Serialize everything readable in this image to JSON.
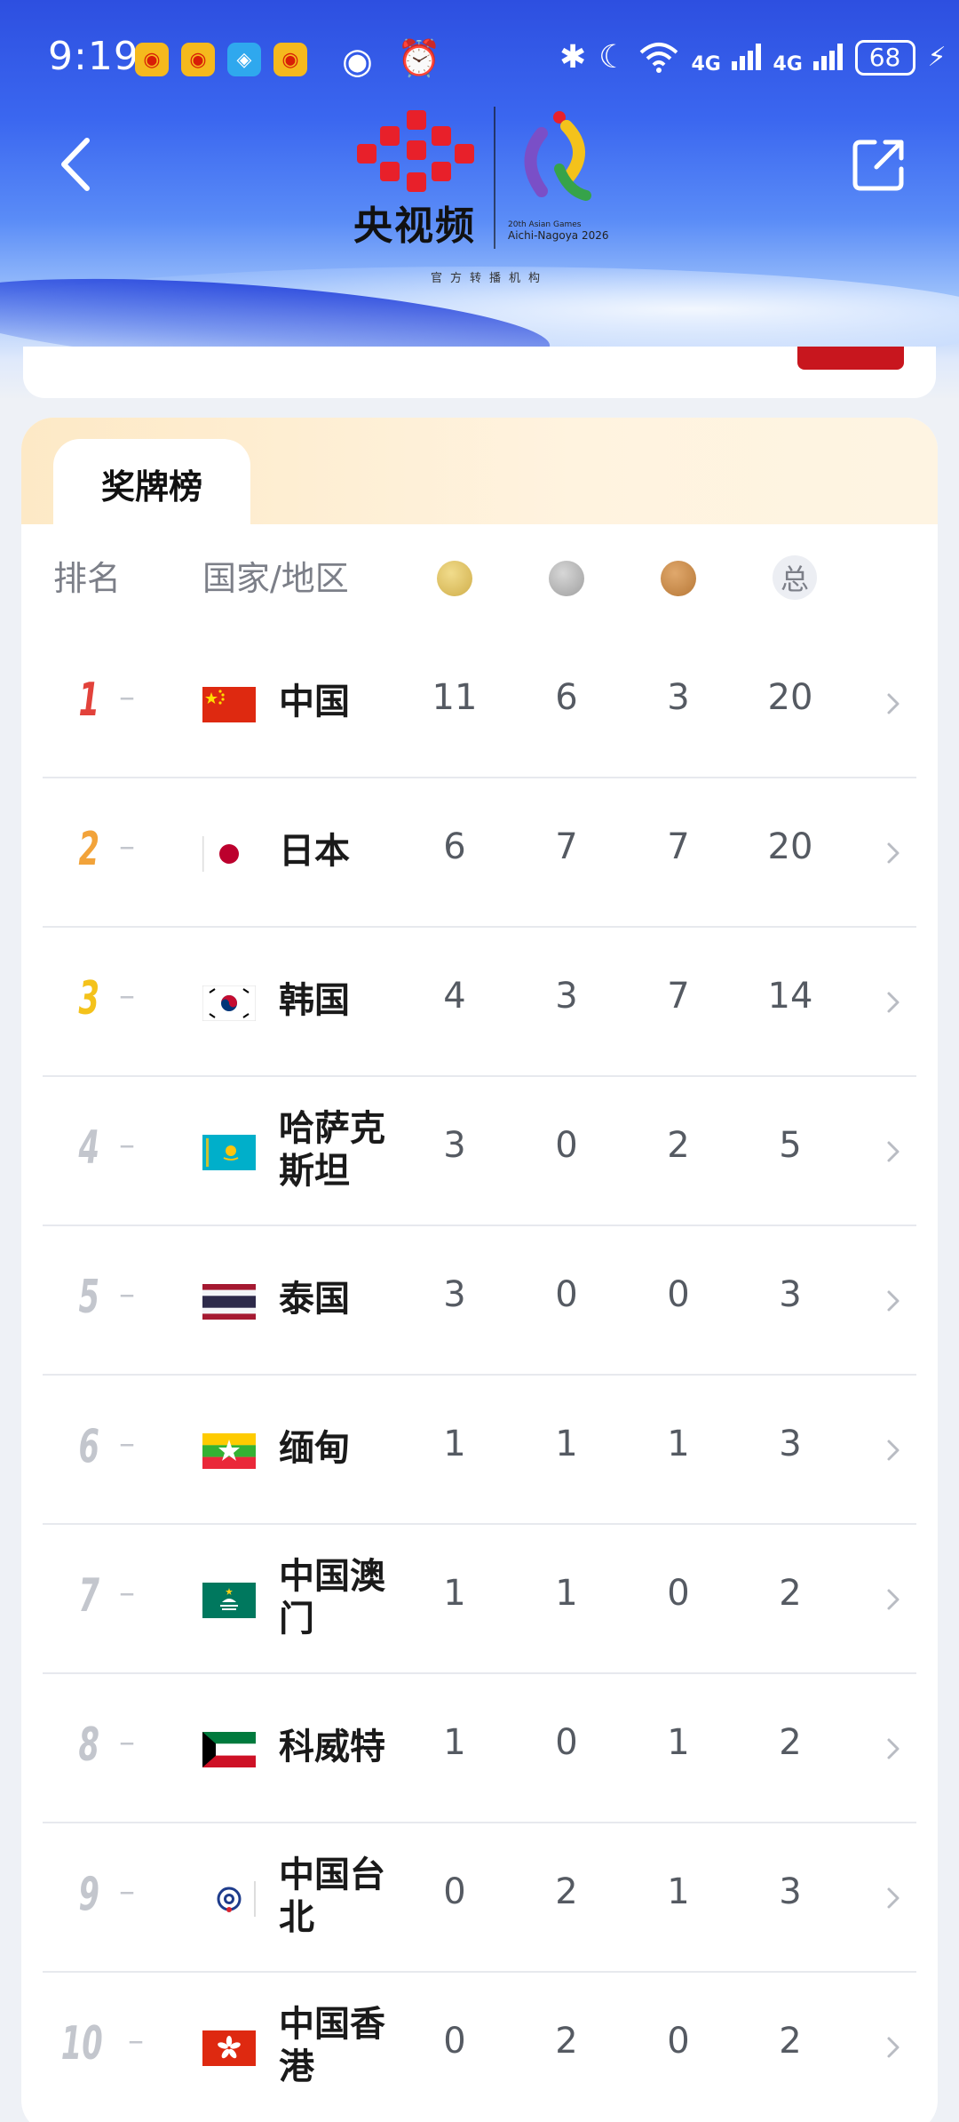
{
  "status_bar": {
    "time": "9:19",
    "signal1": "4G",
    "signal2": "4G",
    "battery": "68"
  },
  "header": {
    "logo_text": "央视频",
    "games_line1": "20th Asian Games",
    "games_line2": "Aichi-Nagoya 2026",
    "org": "官方转播机构"
  },
  "panel": {
    "tab_label": "奖牌榜",
    "col_rank": "排名",
    "col_country": "国家/地区",
    "col_total": "总"
  },
  "colors": {
    "rank1": "#e2423b",
    "rank2": "#f2a33a",
    "rank3": "#f4c21b",
    "rank_other": "#c3c6cd"
  },
  "rows": [
    {
      "rank": "1",
      "name": "中国",
      "gold": "11",
      "silver": "6",
      "bronze": "3",
      "total": "20",
      "flag": "china-flag"
    },
    {
      "rank": "2",
      "name": "日本",
      "gold": "6",
      "silver": "7",
      "bronze": "7",
      "total": "20",
      "flag": "japan-flag"
    },
    {
      "rank": "3",
      "name": "韩国",
      "gold": "4",
      "silver": "3",
      "bronze": "7",
      "total": "14",
      "flag": "korea-flag"
    },
    {
      "rank": "4",
      "name": "哈萨克斯坦",
      "gold": "3",
      "silver": "0",
      "bronze": "2",
      "total": "5",
      "flag": "kazakhstan-flag"
    },
    {
      "rank": "5",
      "name": "泰国",
      "gold": "3",
      "silver": "0",
      "bronze": "0",
      "total": "3",
      "flag": "thailand-flag"
    },
    {
      "rank": "6",
      "name": "缅甸",
      "gold": "1",
      "silver": "1",
      "bronze": "1",
      "total": "3",
      "flag": "myanmar-flag"
    },
    {
      "rank": "7",
      "name": "中国澳门",
      "gold": "1",
      "silver": "1",
      "bronze": "0",
      "total": "2",
      "flag": "macau-flag"
    },
    {
      "rank": "8",
      "name": "科威特",
      "gold": "1",
      "silver": "0",
      "bronze": "1",
      "total": "2",
      "flag": "kuwait-flag"
    },
    {
      "rank": "9",
      "name": "中国台北",
      "gold": "0",
      "silver": "2",
      "bronze": "1",
      "total": "3",
      "flag": "chinese-taipei-flag"
    },
    {
      "rank": "10",
      "name": "中国香港",
      "gold": "0",
      "silver": "2",
      "bronze": "0",
      "total": "2",
      "flag": "hong-kong-flag"
    }
  ]
}
